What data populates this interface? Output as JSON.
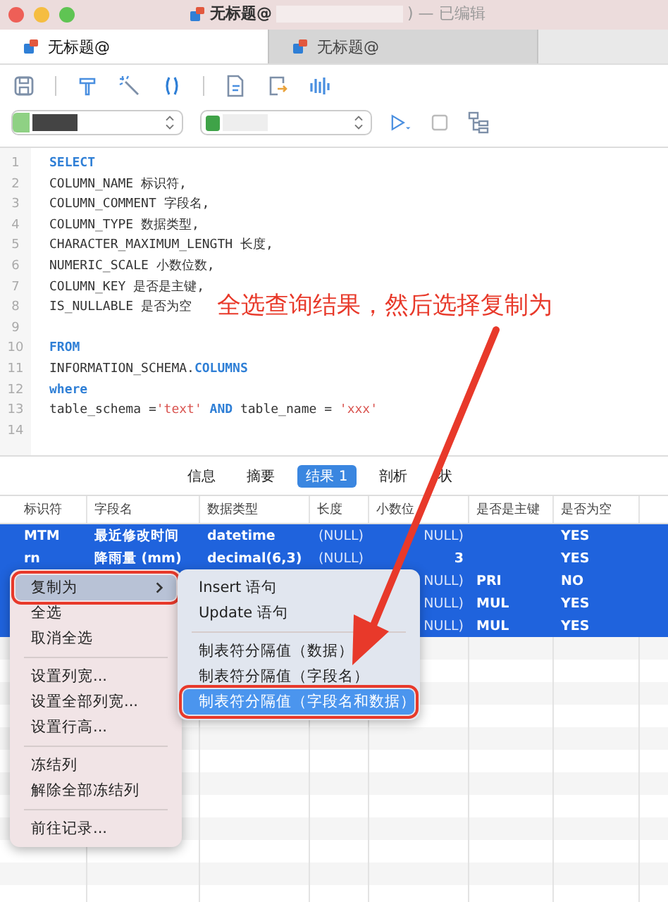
{
  "window": {
    "title": "无标题@",
    "edited": ") — 已编辑"
  },
  "tabs": [
    {
      "label": "无标题@",
      "selected": true
    },
    {
      "label": "无标题@",
      "selected": false
    }
  ],
  "editor": {
    "lines": [
      {
        "number": "1",
        "segments": [
          {
            "text": "SELECT",
            "kind": "keyword"
          }
        ]
      },
      {
        "number": "2",
        "segments": [
          {
            "text": "COLUMN_NAME 标识符,",
            "kind": "plain"
          }
        ]
      },
      {
        "number": "3",
        "segments": [
          {
            "text": "COLUMN_COMMENT 字段名,",
            "kind": "plain"
          }
        ]
      },
      {
        "number": "4",
        "segments": [
          {
            "text": "COLUMN_TYPE 数据类型,",
            "kind": "plain"
          }
        ]
      },
      {
        "number": "5",
        "segments": [
          {
            "text": "CHARACTER_MAXIMUM_LENGTH 长度,",
            "kind": "plain"
          }
        ]
      },
      {
        "number": "6",
        "segments": [
          {
            "text": "NUMERIC_SCALE 小数位数,",
            "kind": "plain"
          }
        ]
      },
      {
        "number": "7",
        "segments": [
          {
            "text": "COLUMN_KEY 是否是主键,",
            "kind": "plain"
          }
        ]
      },
      {
        "number": "8",
        "segments": [
          {
            "text": "IS_NULLABLE 是否为空",
            "kind": "plain"
          }
        ]
      },
      {
        "number": "9"
      },
      {
        "number": "10",
        "segments": [
          {
            "text": "FROM",
            "kind": "keyword"
          }
        ]
      },
      {
        "number": "11",
        "segments": [
          {
            "text": "INFORMATION_SCHEMA.",
            "kind": "plain"
          },
          {
            "text": "COLUMNS",
            "kind": "keyword"
          }
        ]
      },
      {
        "number": "12",
        "segments": [
          {
            "text": "where",
            "kind": "keyword"
          }
        ]
      },
      {
        "number": "13",
        "segments": [
          {
            "text": "table_schema =",
            "kind": "plain"
          },
          {
            "text": "'text'",
            "kind": "string"
          },
          {
            "text": " AND ",
            "kind": "keyword"
          },
          {
            "text": "table_name = ",
            "kind": "plain"
          },
          {
            "text": "'xxx'",
            "kind": "string"
          }
        ]
      },
      {
        "number": "14"
      }
    ]
  },
  "annotation": {
    "text": "全选查询结果，然后选择复制为"
  },
  "result_tabs": [
    {
      "label": "信息",
      "selected": false
    },
    {
      "label": "摘要",
      "selected": false
    },
    {
      "label": "结果 1",
      "selected": true
    },
    {
      "label": "剖析",
      "selected": false
    },
    {
      "label": "状",
      "selected": false
    }
  ],
  "table": {
    "columns": [
      "标识符",
      "字段名",
      "数据类型",
      "长度",
      "小数位",
      "是否是主键",
      "是否为空"
    ],
    "rows": [
      {
        "selected": true,
        "cells": [
          "MTM",
          "最近修改时间",
          "datetime",
          "(NULL)",
          "NULL)",
          "",
          "YES"
        ]
      },
      {
        "selected": true,
        "cells": [
          "rn",
          "降雨量 (mm)",
          "decimal(6,3)",
          "(NULL)",
          "3",
          "",
          "YES"
        ]
      },
      {
        "selected": true,
        "cells": [
          "",
          "",
          "",
          "",
          "NULL)",
          "PRI",
          "NO"
        ]
      },
      {
        "selected": true,
        "cells": [
          "",
          "",
          "",
          "",
          "NULL)",
          "MUL",
          "YES"
        ]
      },
      {
        "selected": true,
        "cells": [
          "",
          "",
          "",
          "",
          "NULL)",
          "MUL",
          "YES"
        ]
      }
    ]
  },
  "context_menu": {
    "items": [
      {
        "kind": "submenu",
        "label": "复制为",
        "selected": true,
        "annotated": true
      },
      {
        "kind": "item",
        "label": "全选",
        "selected": false,
        "annotated": false
      },
      {
        "kind": "item",
        "label": "取消全选",
        "selected": false,
        "annotated": false
      },
      {
        "kind": "separator"
      },
      {
        "kind": "item",
        "label": "设置列宽...",
        "selected": false,
        "annotated": false
      },
      {
        "kind": "item",
        "label": "设置全部列宽...",
        "selected": false,
        "annotated": false
      },
      {
        "kind": "item",
        "label": "设置行高...",
        "selected": false,
        "annotated": false
      },
      {
        "kind": "separator"
      },
      {
        "kind": "item",
        "label": "冻结列",
        "selected": false,
        "annotated": false
      },
      {
        "kind": "item",
        "label": "解除全部冻结列",
        "selected": false,
        "annotated": false
      },
      {
        "kind": "separator"
      },
      {
        "kind": "item",
        "label": "前往记录...",
        "selected": false,
        "annotated": false
      }
    ],
    "submenu": [
      {
        "kind": "item",
        "label": "Insert 语句",
        "selected": false,
        "annotated": false
      },
      {
        "kind": "item",
        "label": "Update 语句",
        "selected": false,
        "annotated": false
      },
      {
        "kind": "separator"
      },
      {
        "kind": "item",
        "label": "制表符分隔值（数据）",
        "selected": false,
        "annotated": false
      },
      {
        "kind": "item",
        "label": "制表符分隔值（字段名）",
        "selected": false,
        "annotated": false
      },
      {
        "kind": "item",
        "label": "制表符分隔值（字段名和数据）",
        "selected": true,
        "annotated": true
      }
    ]
  }
}
